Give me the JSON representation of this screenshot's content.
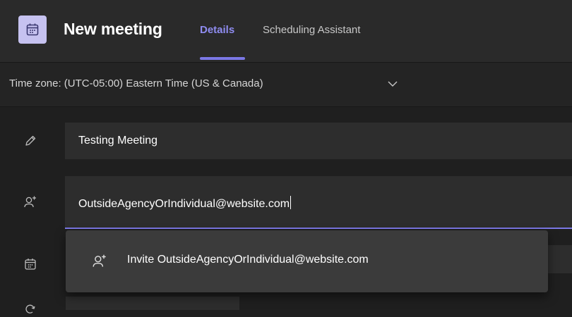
{
  "header": {
    "title": "New meeting",
    "tabs": [
      {
        "label": "Details",
        "active": true
      },
      {
        "label": "Scheduling Assistant",
        "active": false
      }
    ],
    "app_icon": "calendar-icon"
  },
  "timezone": {
    "label": "Time zone: (UTC-05:00) Eastern Time (US & Canada)",
    "chevron_icon": "chevron-down-icon"
  },
  "form": {
    "title_field": {
      "value": "Testing Meeting",
      "icon": "pencil-icon"
    },
    "attendees_field": {
      "value": "OutsideAgencyOrIndividual@website.com",
      "icon": "add-person-icon"
    },
    "date_icon": "calendar-icon",
    "repeat_icon": "repeat-icon"
  },
  "suggestion": {
    "label": "Invite OutsideAgencyOrIndividual@website.com",
    "icon": "add-person-icon"
  },
  "colors": {
    "accent": "#7b78e6",
    "app_icon_bg": "#c6c2f0",
    "background": "#1f1f1f",
    "field_bg": "#2d2d2d",
    "dropdown_bg": "#3b3b3b"
  }
}
